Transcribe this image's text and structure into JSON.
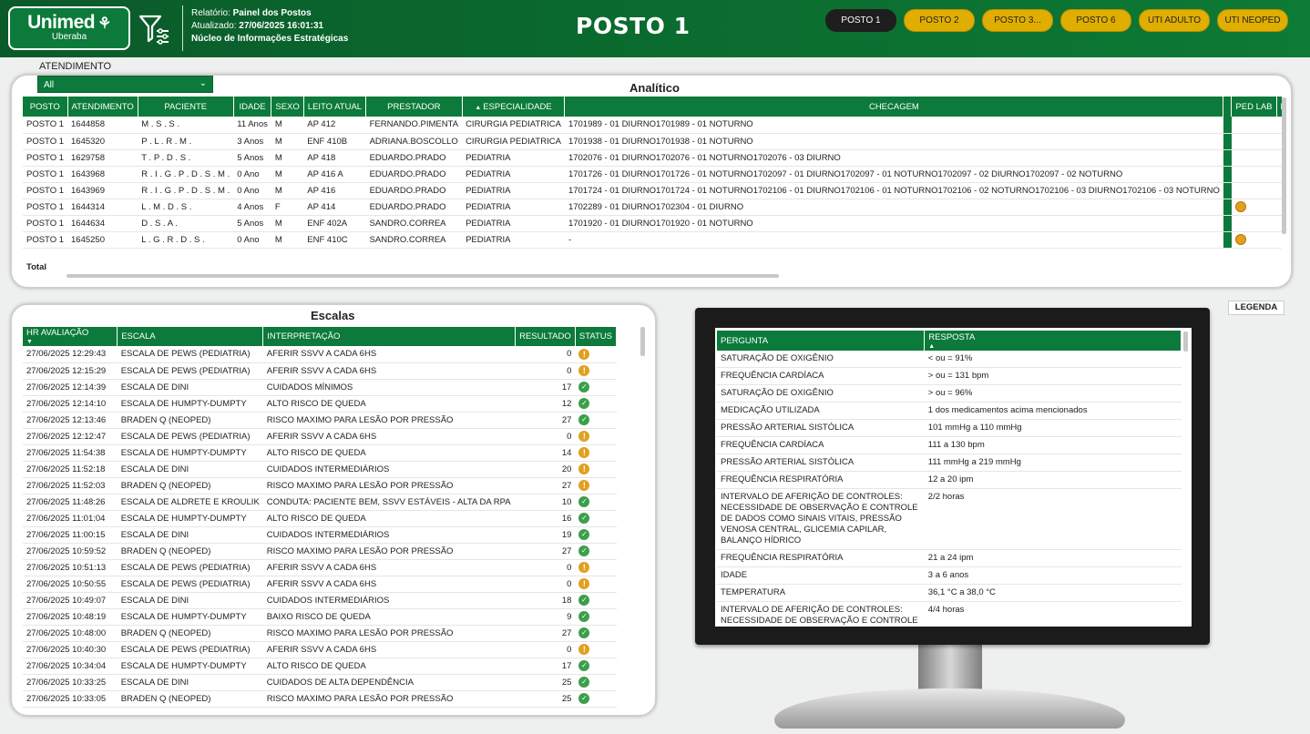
{
  "header": {
    "logo_brand": "Unimed",
    "logo_city": "Uberaba",
    "report_label": "Relatório:",
    "report_value": "Painel dos Postos",
    "updated_label": "Atualizado:",
    "updated_value": "27/06/2025 16:01:31",
    "department": "Núcleo de Informações Estratégicas",
    "page_title": "POSTO 1",
    "nav": [
      {
        "label": "POSTO 1",
        "active": true
      },
      {
        "label": "POSTO 2",
        "active": false
      },
      {
        "label": "POSTO 3...",
        "active": false
      },
      {
        "label": "POSTO 6",
        "active": false
      },
      {
        "label": "UTI ADULTO",
        "active": false
      },
      {
        "label": "UTI NEOPED",
        "active": false
      }
    ]
  },
  "slicer": {
    "label": "ATENDIMENTO",
    "value": "All"
  },
  "analitico": {
    "title": "Analítico",
    "columns": [
      "POSTO",
      "ATENDIMENTO",
      "PACIENTE",
      "IDADE",
      "SEXO",
      "LEITO ATUAL",
      "PRESTADOR",
      "ESPECIALIDADE",
      "CHECAGEM",
      "",
      "PED LAB",
      "EX"
    ],
    "rows": [
      {
        "posto": "POSTO 1",
        "atend": "1644858",
        "pac": "M . S . S .",
        "idade": "11 Anos",
        "sexo": "M",
        "leito": "AP 412",
        "prest": "FERNANDO.PIMENTA",
        "esp": "CIRURGIA PEDIATRICA",
        "chec": "1701989 - 01 DIURNO1701989 - 01 NOTURNO",
        "green": true,
        "pedlab": false
      },
      {
        "posto": "POSTO 1",
        "atend": "1645320",
        "pac": "P . L . R . M .",
        "idade": "3 Anos",
        "sexo": "M",
        "leito": "ENF 410B",
        "prest": "ADRIANA.BOSCOLLO",
        "esp": "CIRURGIA PEDIATRICA",
        "chec": "1701938 - 01 DIURNO1701938 - 01 NOTURNO",
        "green": true,
        "pedlab": false
      },
      {
        "posto": "POSTO 1",
        "atend": "1629758",
        "pac": "T . P . D . S .",
        "idade": "5 Anos",
        "sexo": "M",
        "leito": "AP 418",
        "prest": "EDUARDO.PRADO",
        "esp": "PEDIATRIA",
        "chec": "1702076 - 01 DIURNO1702076 - 01 NOTURNO1702076 - 03 DIURNO",
        "green": true,
        "pedlab": false
      },
      {
        "posto": "POSTO 1",
        "atend": "1643968",
        "pac": "R . I . G . P . D . S . M .",
        "idade": "0 Ano",
        "sexo": "M",
        "leito": "AP 416 A",
        "prest": "EDUARDO.PRADO",
        "esp": "PEDIATRIA",
        "chec": "1701726 - 01 DIURNO1701726 - 01 NOTURNO1702097 - 01 DIURNO1702097 - 01 NOTURNO1702097 - 02 DIURNO1702097 - 02 NOTURNO",
        "green": true,
        "pedlab": false
      },
      {
        "posto": "POSTO 1",
        "atend": "1643969",
        "pac": "R . I . G . P . D . S . M .",
        "idade": "0 Ano",
        "sexo": "M",
        "leito": "AP 416",
        "prest": "EDUARDO.PRADO",
        "esp": "PEDIATRIA",
        "chec": "1701724 - 01 DIURNO1701724 - 01 NOTURNO1702106 - 01 DIURNO1702106 - 01 NOTURNO1702106 - 02 NOTURNO1702106 - 03 DIURNO1702106 - 03 NOTURNO",
        "green": true,
        "pedlab": false
      },
      {
        "posto": "POSTO 1",
        "atend": "1644314",
        "pac": "L . M . D . S .",
        "idade": "4 Anos",
        "sexo": "F",
        "leito": "AP 414",
        "prest": "EDUARDO.PRADO",
        "esp": "PEDIATRIA",
        "chec": "1702289 - 01 DIURNO1702304 - 01 DIURNO",
        "green": true,
        "pedlab": true
      },
      {
        "posto": "POSTO 1",
        "atend": "1644634",
        "pac": "D . S . A .",
        "idade": "5 Anos",
        "sexo": "M",
        "leito": "ENF 402A",
        "prest": "SANDRO.CORREA",
        "esp": "PEDIATRIA",
        "chec": "1701920 - 01 DIURNO1701920 - 01 NOTURNO",
        "green": true,
        "pedlab": false
      },
      {
        "posto": "POSTO 1",
        "atend": "1645250",
        "pac": "L . G . R . D . S .",
        "idade": "0 Ano",
        "sexo": "M",
        "leito": "ENF 410C",
        "prest": "SANDRO.CORREA",
        "esp": "PEDIATRIA",
        "chec": "-",
        "green": true,
        "pedlab": true
      }
    ],
    "total_label": "Total"
  },
  "escalas": {
    "title": "Escalas",
    "columns": [
      "HR AVALIAÇÃO",
      "ESCALA",
      "INTERPRETAÇÃO",
      "RESULTADO",
      "STATUS"
    ],
    "rows": [
      {
        "hr": "27/06/2025 12:29:43",
        "esc": "ESCALA DE PEWS (PEDIATRIA)",
        "int": "AFERIR SSVV A CADA 6HS",
        "res": "0",
        "st": "warn"
      },
      {
        "hr": "27/06/2025 12:15:29",
        "esc": "ESCALA DE PEWS (PEDIATRIA)",
        "int": "AFERIR SSVV A CADA 6HS",
        "res": "0",
        "st": "warn"
      },
      {
        "hr": "27/06/2025 12:14:39",
        "esc": "ESCALA DE DINI",
        "int": "CUIDADOS MÍNIMOS",
        "res": "17",
        "st": "ok"
      },
      {
        "hr": "27/06/2025 12:14:10",
        "esc": "ESCALA DE HUMPTY-DUMPTY",
        "int": "ALTO RISCO DE QUEDA",
        "res": "12",
        "st": "ok"
      },
      {
        "hr": "27/06/2025 12:13:46",
        "esc": "BRADEN Q (NEOPED)",
        "int": "RISCO MAXIMO PARA LESÃO POR PRESSÃO",
        "res": "27",
        "st": "ok"
      },
      {
        "hr": "27/06/2025 12:12:47",
        "esc": "ESCALA DE PEWS (PEDIATRIA)",
        "int": "AFERIR SSVV A CADA 6HS",
        "res": "0",
        "st": "warn"
      },
      {
        "hr": "27/06/2025 11:54:38",
        "esc": "ESCALA DE HUMPTY-DUMPTY",
        "int": "ALTO RISCO DE QUEDA",
        "res": "14",
        "st": "warn"
      },
      {
        "hr": "27/06/2025 11:52:18",
        "esc": "ESCALA DE DINI",
        "int": "CUIDADOS INTERMEDIÁRIOS",
        "res": "20",
        "st": "warn"
      },
      {
        "hr": "27/06/2025 11:52:03",
        "esc": "BRADEN Q (NEOPED)",
        "int": "RISCO MAXIMO PARA LESÃO POR PRESSÃO",
        "res": "27",
        "st": "warn"
      },
      {
        "hr": "27/06/2025 11:48:26",
        "esc": "ESCALA DE ALDRETE E KROULIK",
        "int": "CONDUTA: PACIENTE BEM, SSVV ESTÁVEIS - ALTA DA RPA",
        "res": "10",
        "st": "ok"
      },
      {
        "hr": "27/06/2025 11:01:04",
        "esc": "ESCALA DE HUMPTY-DUMPTY",
        "int": "ALTO RISCO DE QUEDA",
        "res": "16",
        "st": "ok"
      },
      {
        "hr": "27/06/2025 11:00:15",
        "esc": "ESCALA DE DINI",
        "int": "CUIDADOS INTERMEDIÁRIOS",
        "res": "19",
        "st": "ok"
      },
      {
        "hr": "27/06/2025 10:59:52",
        "esc": "BRADEN Q (NEOPED)",
        "int": "RISCO MAXIMO PARA LESÃO POR PRESSÃO",
        "res": "27",
        "st": "ok"
      },
      {
        "hr": "27/06/2025 10:51:13",
        "esc": "ESCALA DE PEWS (PEDIATRIA)",
        "int": "AFERIR SSVV A CADA 6HS",
        "res": "0",
        "st": "warn"
      },
      {
        "hr": "27/06/2025 10:50:55",
        "esc": "ESCALA DE PEWS (PEDIATRIA)",
        "int": "AFERIR SSVV A CADA 6HS",
        "res": "0",
        "st": "warn"
      },
      {
        "hr": "27/06/2025 10:49:07",
        "esc": "ESCALA DE DINI",
        "int": "CUIDADOS INTERMEDIÁRIOS",
        "res": "18",
        "st": "ok"
      },
      {
        "hr": "27/06/2025 10:48:19",
        "esc": "ESCALA DE HUMPTY-DUMPTY",
        "int": "BAIXO RISCO DE QUEDA",
        "res": "9",
        "st": "ok"
      },
      {
        "hr": "27/06/2025 10:48:00",
        "esc": "BRADEN Q (NEOPED)",
        "int": "RISCO MAXIMO PARA LESÃO POR PRESSÃO",
        "res": "27",
        "st": "ok"
      },
      {
        "hr": "27/06/2025 10:40:30",
        "esc": "ESCALA DE PEWS (PEDIATRIA)",
        "int": "AFERIR SSVV A CADA 6HS",
        "res": "0",
        "st": "warn"
      },
      {
        "hr": "27/06/2025 10:34:04",
        "esc": "ESCALA DE HUMPTY-DUMPTY",
        "int": "ALTO RISCO DE QUEDA",
        "res": "17",
        "st": "ok"
      },
      {
        "hr": "27/06/2025 10:33:25",
        "esc": "ESCALA DE DINI",
        "int": "CUIDADOS DE ALTA DEPENDÊNCIA",
        "res": "25",
        "st": "ok"
      },
      {
        "hr": "27/06/2025 10:33:05",
        "esc": "BRADEN Q (NEOPED)",
        "int": "RISCO MAXIMO PARA LESÃO POR PRESSÃO",
        "res": "25",
        "st": "ok"
      }
    ]
  },
  "legenda": {
    "button_label": "LEGENDA",
    "columns": [
      "PERGUNTA",
      "RESPOSTA"
    ],
    "rows": [
      {
        "q": "SATURAÇÃO DE OXIGÊNIO",
        "a": "< ou = 91%"
      },
      {
        "q": "FREQUÊNCIA CARDÍACA",
        "a": "> ou = 131 bpm"
      },
      {
        "q": "SATURAÇÃO DE OXIGÊNIO",
        "a": "> ou = 96%"
      },
      {
        "q": "MEDICAÇÃO UTILIZADA",
        "a": "1 dos medicamentos acima mencionados"
      },
      {
        "q": "PRESSÃO ARTERIAL SISTÓLICA",
        "a": "101 mmHg a 110 mmHg"
      },
      {
        "q": "FREQUÊNCIA CARDÍACA",
        "a": "111 a 130 bpm"
      },
      {
        "q": "PRESSÃO ARTERIAL SISTÓLICA",
        "a": "111 mmHg a 219 mmHg"
      },
      {
        "q": "FREQUÊNCIA RESPIRATÓRIA",
        "a": "12 a 20 ipm"
      },
      {
        "q": "INTERVALO DE AFERIÇÃO DE CONTROLES: NECESSIDADE DE OBSERVAÇÃO E CONTROLE DE DADOS COMO SINAIS VITAIS, PRESSÃO VENOSA CENTRAL, GLICEMIA CAPILAR, BALANÇO HÍDRICO",
        "a": "2/2 horas"
      },
      {
        "q": "FREQUÊNCIA RESPIRATÓRIA",
        "a": "21 a 24 ipm"
      },
      {
        "q": "IDADE",
        "a": "3 a 6 anos"
      },
      {
        "q": "TEMPERATURA",
        "a": "36,1 °C a 38,0 °C"
      },
      {
        "q": "INTERVALO DE AFERIÇÃO DE CONTROLES: NECESSIDADE DE OBSERVAÇÃO E CONTROLE DE",
        "a": "4/4 horas"
      }
    ]
  },
  "colors": {
    "brand_green": "#0b7a3a",
    "nav_yellow": "#e0ae00",
    "warn": "#e0a020",
    "ok": "#3aa04a"
  }
}
